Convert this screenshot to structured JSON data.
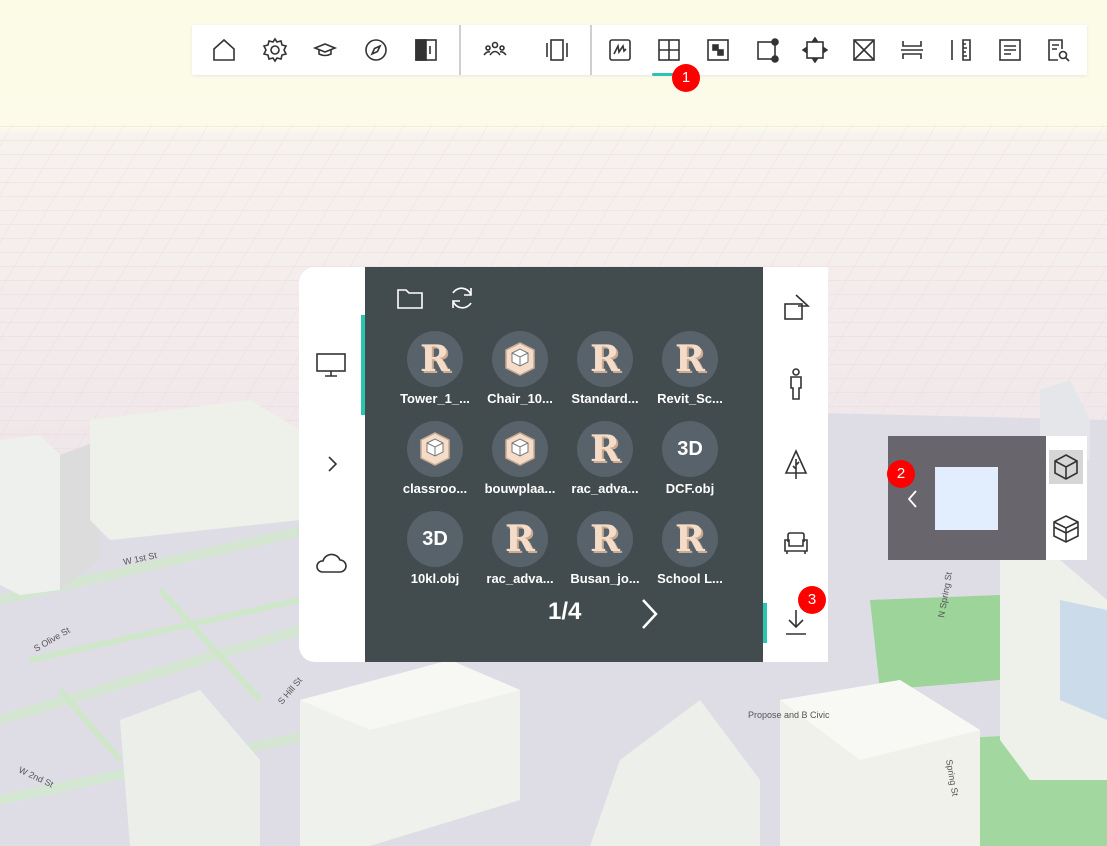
{
  "toolbar": {
    "buttons": [
      {
        "name": "home-icon"
      },
      {
        "name": "gear-icon"
      },
      {
        "name": "graduation-cap-icon"
      },
      {
        "name": "compass-icon"
      },
      {
        "name": "split-view-icon"
      },
      {
        "name": "people-icon"
      },
      {
        "name": "frame-icon"
      },
      {
        "name": "sketch-icon"
      },
      {
        "name": "add-square-icon"
      },
      {
        "name": "checker-icon"
      },
      {
        "name": "node-square-icon"
      },
      {
        "name": "move-square-icon"
      },
      {
        "name": "x-square-icon"
      },
      {
        "name": "section-icon"
      },
      {
        "name": "ruler-icon"
      },
      {
        "name": "notes-icon"
      },
      {
        "name": "document-search-icon"
      }
    ],
    "badge_1": "1"
  },
  "left_panel": {
    "items": [
      {
        "name": "monitor-icon"
      },
      {
        "name": "chevron-right-icon"
      },
      {
        "name": "cloud-icon"
      }
    ]
  },
  "main_panel": {
    "header_icons": [
      "folder-icon",
      "refresh-icon"
    ],
    "items": [
      {
        "label": "Tower_1_...",
        "icon": "R"
      },
      {
        "label": "Chair_10...",
        "icon": "SK"
      },
      {
        "label": "Standard...",
        "icon": "R"
      },
      {
        "label": "Revit_Sc...",
        "icon": "R"
      },
      {
        "label": "classroo...",
        "icon": "SK"
      },
      {
        "label": "bouwplaa...",
        "icon": "SK"
      },
      {
        "label": "rac_adva...",
        "icon": "R"
      },
      {
        "label": "DCF.obj",
        "icon": "3D"
      },
      {
        "label": "10kl.obj",
        "icon": "3D"
      },
      {
        "label": "rac_adva...",
        "icon": "R"
      },
      {
        "label": "Busan_jo...",
        "icon": "R"
      },
      {
        "label": "School L...",
        "icon": "R"
      }
    ],
    "page": "1/4"
  },
  "right_panel": {
    "items": [
      {
        "name": "shapes-icon"
      },
      {
        "name": "person-icon"
      },
      {
        "name": "tree-icon"
      },
      {
        "name": "armchair-icon"
      },
      {
        "name": "download-icon"
      }
    ],
    "badge_3": "3"
  },
  "view_widget": {
    "badge_2": "2"
  },
  "map_labels": {
    "w1st": "W 1st St",
    "solive": "S Olive St",
    "shill": "S Hill St",
    "w2nd": "W 2nd St",
    "nspring": "N Spring St",
    "spring": "Spring St",
    "propose": "Propose and B Civic"
  }
}
